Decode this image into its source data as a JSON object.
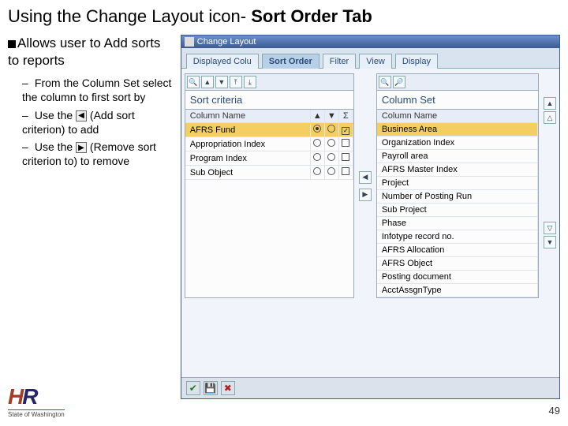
{
  "title_prefix": "Using the Change Layout icon- ",
  "title_bold": "Sort Order Tab",
  "main_point": "Allows user to Add sorts to reports",
  "sub_points": [
    "From the Column Set select the column to first sort by",
    "Use the",
    "Use the"
  ],
  "sub_point_tail": {
    "1": "(Add sort criterion) to add",
    "2": "(Remove sort criterion to) to remove"
  },
  "dialog": {
    "title": "Change Layout",
    "tabs": [
      "Displayed Colu",
      "Sort Order",
      "Filter",
      "View",
      "Display"
    ],
    "active_tab": 1,
    "left_panel": {
      "title": "Sort criteria",
      "header": "Column Name",
      "rows": [
        "AFRS Fund",
        "Appropriation Index",
        "Program Index",
        "Sub Object"
      ]
    },
    "right_panel": {
      "title": "Column Set",
      "header": "Column Name",
      "rows": [
        "Business Area",
        "Organization Index",
        "Payroll area",
        "AFRS Master Index",
        "Project",
        "Number of Posting Run",
        "Sub Project",
        "Phase",
        "Infotype record no.",
        "AFRS Allocation",
        "AFRS Object",
        "Posting document",
        "AcctAssgnType"
      ]
    }
  },
  "footer_label": "State of Washington",
  "page_number": "49"
}
